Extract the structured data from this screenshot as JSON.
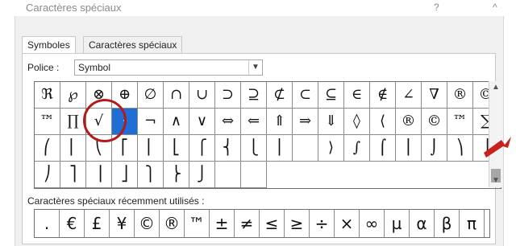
{
  "window": {
    "title": "Caractères spéciaux",
    "help_label": "?",
    "close_label": "^"
  },
  "tabs": [
    {
      "label": "Symboles"
    },
    {
      "label": "Caractères spéciaux"
    }
  ],
  "font": {
    "label": "Police :",
    "value": "Symbol"
  },
  "grid": {
    "selected": {
      "row": 1,
      "col": 3
    },
    "rows": [
      [
        "ℜ",
        "℘",
        "⊗",
        "⊕",
        "∅",
        "∩",
        "∪",
        "⊃",
        "⊇",
        "⊄",
        "⊂",
        "⊆",
        "∈",
        "∉",
        "∠",
        "∇",
        "®",
        "©"
      ],
      [
        "™",
        "∏",
        "√",
        "·",
        "¬",
        "∧",
        "∨",
        "⇔",
        "⇐",
        "⇑",
        "⇒",
        "⇓",
        "◊",
        "⟨",
        "®",
        "©",
        "™",
        "∑"
      ],
      [
        "⎛",
        "⎜",
        "⎝",
        "⎡",
        "⎢",
        "⎣",
        "⎧",
        "⎨",
        "⎩",
        "⎪",
        "",
        "⟩",
        "∫",
        "⌠",
        "⎮",
        "⌡",
        "⎞",
        "⎟"
      ],
      [
        "⎠",
        "⎤",
        "⎥",
        "⎦",
        "⎫",
        "⎬",
        "⎭",
        "",
        ""
      ]
    ]
  },
  "recent": {
    "label": "Caractères spéciaux récemment utilisés :",
    "items": [
      ".",
      "€",
      "£",
      "¥",
      "©",
      "®",
      "™",
      "±",
      "≠",
      "≤",
      "≥",
      "÷",
      "×",
      "∞",
      "µ",
      "α",
      "β",
      "π"
    ]
  },
  "colors": {
    "selection": "#1e6ed6",
    "annotation": "#b41a1a",
    "dialog_bg": "#f0f0f0"
  }
}
